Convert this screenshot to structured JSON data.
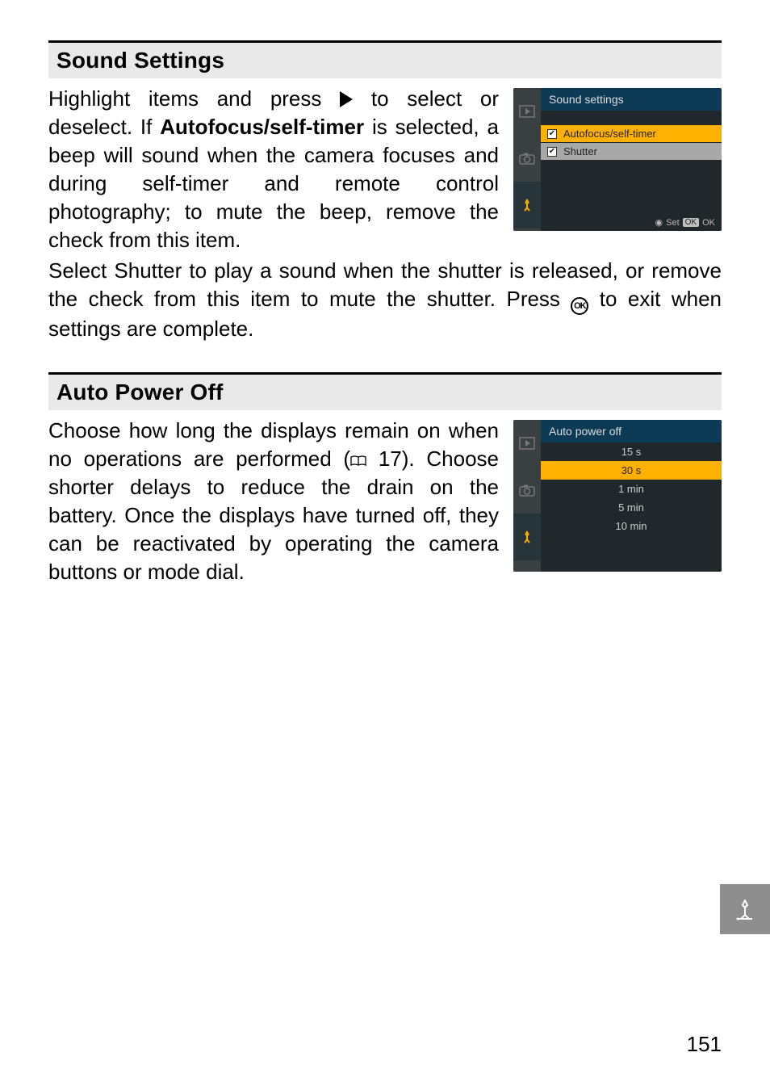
{
  "sections": {
    "sound": {
      "heading": "Sound Settings",
      "para1_a": "Highlight items and press ",
      "para1_b": " to select or deselect. If ",
      "autofocus_bold": "Autofocus/self-timer",
      "para1_c": " is selected, a beep will sound when the camera focuses and during self-timer and remote control photography; to mute the beep, remove the check from this item.",
      "para2_a": "Select ",
      "shutter_bold": "Shutter",
      "para2_b": " to play a sound when the shutter is released, or remove the check from this item to mute the shutter. Press ",
      "ok_text": "OK",
      "para2_c": " to exit when settings are complete."
    },
    "apo": {
      "heading": "Auto Power Off",
      "para_a": "Choose how long the displays remain on when no operations are performed (",
      "ref": " 17). Choose shorter delays to reduce the drain on the battery. Once the displays have turned off, they can be reactivated by operating the camera buttons or mode dial."
    }
  },
  "screenshots": {
    "sound": {
      "title": "Sound settings",
      "items": [
        {
          "label": "Autofocus/self-timer",
          "checked": true
        },
        {
          "label": "Shutter",
          "checked": true
        }
      ],
      "set_label": "Set",
      "ok_label": "OK"
    },
    "apo": {
      "title": "Auto power off",
      "options": [
        "15 s",
        "30 s",
        "1 min",
        "5 min",
        "10 min"
      ],
      "selected": "30 s"
    }
  },
  "page_number": "151"
}
